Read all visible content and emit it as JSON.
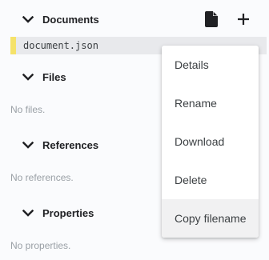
{
  "sections": {
    "documents": {
      "title": "Documents"
    },
    "files": {
      "title": "Files",
      "empty": "No files."
    },
    "references": {
      "title": "References",
      "empty": "No references."
    },
    "properties": {
      "title": "Properties",
      "empty": "No properties."
    }
  },
  "documents": {
    "files": [
      {
        "name": "document.json",
        "marker_color": "#f5e26a"
      }
    ],
    "actions": [
      {
        "icon": "file-icon"
      },
      {
        "icon": "plus-icon"
      }
    ]
  },
  "context_menu": {
    "items": [
      {
        "label": "Details"
      },
      {
        "label": "Rename"
      },
      {
        "label": "Download"
      },
      {
        "label": "Delete"
      },
      {
        "label": "Copy filename",
        "hovered": true
      }
    ]
  },
  "colors": {
    "background": "#fafbfd",
    "file_row": "#e8e9ec",
    "file_marker": "#f5e26a",
    "menu_hover": "#f1f1f2"
  }
}
